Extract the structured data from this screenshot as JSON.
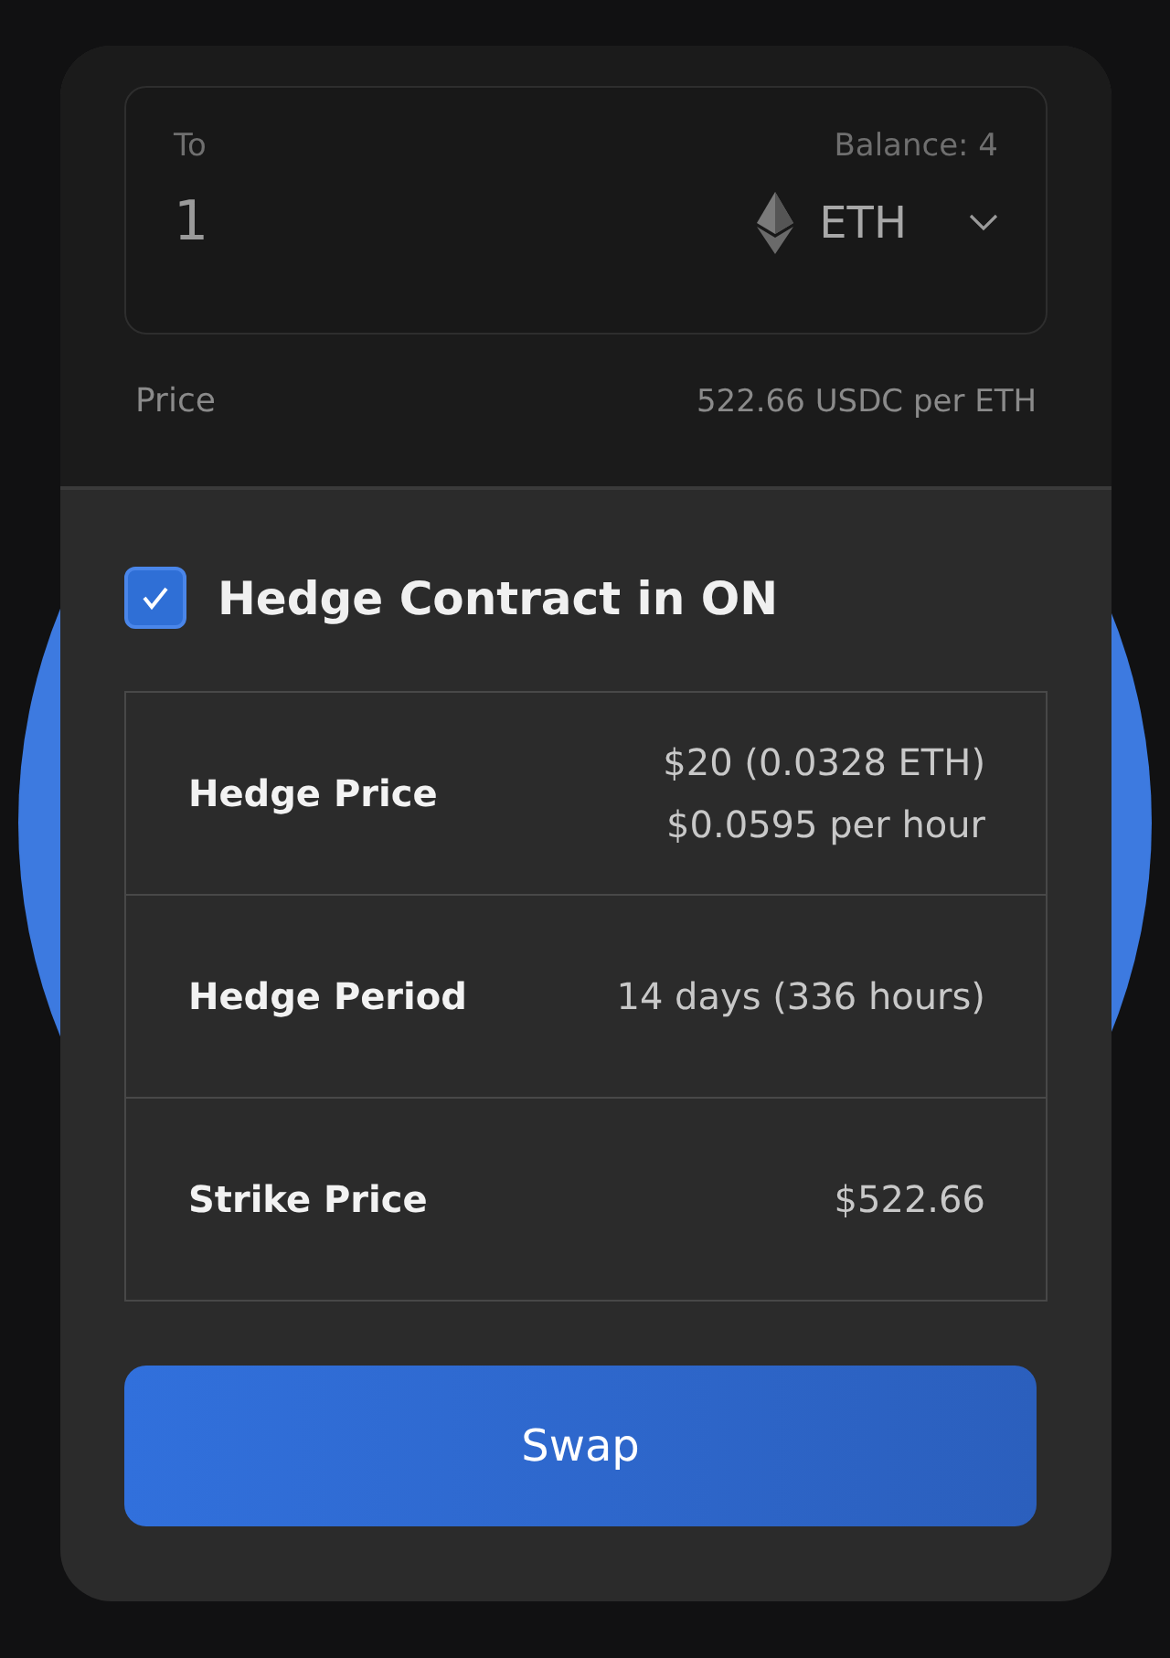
{
  "to_field": {
    "label": "To",
    "balance": "Balance: 4",
    "value": "1",
    "token": "ETH"
  },
  "price": {
    "label": "Price",
    "value": "522.66 USDC per ETH"
  },
  "hedge": {
    "label": "Hedge Contract in ON",
    "checked": true
  },
  "details": [
    {
      "label": "Hedge Price",
      "values": [
        "$20 (0.0328 ETH)",
        "$0.0595 per hour"
      ]
    },
    {
      "label": "Hedge Period",
      "values": [
        "14 days (336 hours)"
      ]
    },
    {
      "label": "Strike Price",
      "values": [
        "$522.66"
      ]
    }
  ],
  "swap_button": "Swap"
}
